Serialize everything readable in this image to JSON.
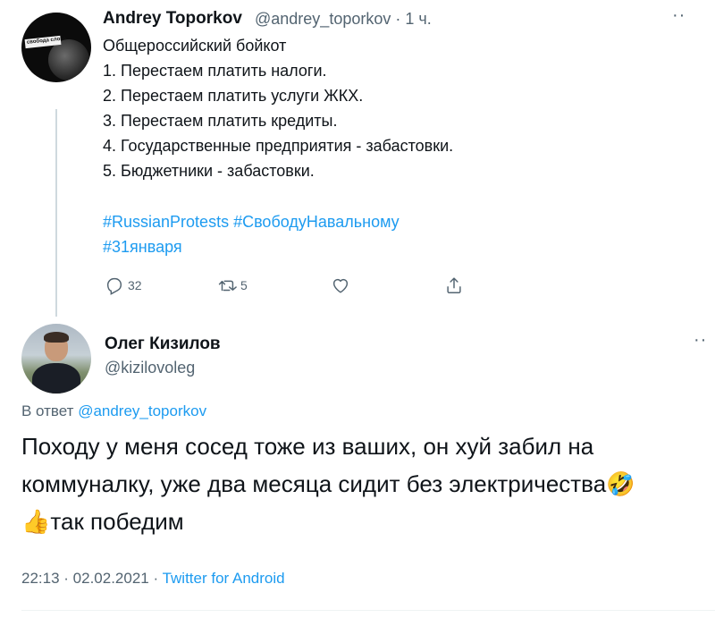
{
  "tweet1": {
    "author_name": "Andrey Toporkov",
    "author_handle": "@andrey_toporkov",
    "time_ago": "1 ч.",
    "avatar_text": "свобода слова",
    "lines": [
      "Общероссийский бойкот",
      "1. Перестаем платить налоги.",
      "2. Перестаем платить услуги ЖКХ.",
      "3. Перестаем платить кредиты.",
      "4. Государственные предприятия - забастовки.",
      "5. Бюджетники - забастовки."
    ],
    "hashtags": [
      "#RussianProtests #СвободуНавальному",
      "#31января"
    ],
    "actions": {
      "reply_count": "32",
      "retweet_count": "5",
      "like_count": "",
      "share_count": ""
    }
  },
  "tweet2": {
    "author_name": "Олег Кизилов",
    "author_handle": "@kizilovoleg",
    "reply_prefix": "В ответ",
    "reply_to": "@andrey_toporkov",
    "lines": [
      "Походу у меня сосед тоже из ваших, он хуй забил на",
      "коммуналку, уже два месяца сидит без электричества",
      "так победим"
    ],
    "emoji_laugh": "🤣",
    "emoji_thumb": "👍",
    "time": "22:13",
    "date": "02.02.2021",
    "source": "Twitter for Android"
  },
  "icons": {
    "more": "more-icon",
    "reply": "reply-icon",
    "retweet": "retweet-icon",
    "like": "heart-icon",
    "share": "share-icon"
  },
  "colors": {
    "accent": "#1d9bf0",
    "muted": "#536471",
    "text": "#0f1419"
  }
}
